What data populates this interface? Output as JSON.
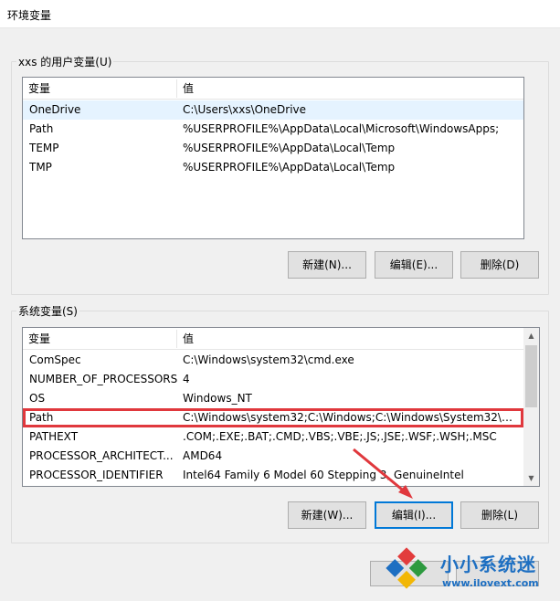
{
  "window": {
    "title": "环境变量"
  },
  "user_vars": {
    "group_label": "xxs 的用户变量(U)",
    "headers": {
      "name": "变量",
      "value": "值"
    },
    "rows": [
      {
        "name": "OneDrive",
        "value": "C:\\Users\\xxs\\OneDrive",
        "selected": true
      },
      {
        "name": "Path",
        "value": "%USERPROFILE%\\AppData\\Local\\Microsoft\\WindowsApps;"
      },
      {
        "name": "TEMP",
        "value": "%USERPROFILE%\\AppData\\Local\\Temp"
      },
      {
        "name": "TMP",
        "value": "%USERPROFILE%\\AppData\\Local\\Temp"
      }
    ],
    "buttons": {
      "new": "新建(N)...",
      "edit": "编辑(E)...",
      "delete": "删除(D)"
    }
  },
  "system_vars": {
    "group_label": "系统变量(S)",
    "headers": {
      "name": "变量",
      "value": "值"
    },
    "rows": [
      {
        "name": "ComSpec",
        "value": "C:\\Windows\\system32\\cmd.exe"
      },
      {
        "name": "NUMBER_OF_PROCESSORS",
        "value": "4"
      },
      {
        "name": "OS",
        "value": "Windows_NT"
      },
      {
        "name": "Path",
        "value": "C:\\Windows\\system32;C:\\Windows;C:\\Windows\\System32\\Wb...",
        "highlighted": true
      },
      {
        "name": "PATHEXT",
        "value": ".COM;.EXE;.BAT;.CMD;.VBS;.VBE;.JS;.JSE;.WSF;.WSH;.MSC"
      },
      {
        "name": "PROCESSOR_ARCHITECT...",
        "value": "AMD64"
      },
      {
        "name": "PROCESSOR_IDENTIFIER",
        "value": "Intel64 Family 6 Model 60 Stepping 3, GenuineIntel"
      }
    ],
    "buttons": {
      "new": "新建(W)...",
      "edit": "编辑(I)...",
      "delete": "删除(L)"
    }
  },
  "watermark": {
    "brand": "小小系统迷",
    "url": "www.ilovext.com"
  },
  "colors": {
    "highlight": "#e0383d",
    "focus": "#0078d7",
    "selection": "#e5f3ff",
    "watermark": "#1d6fc2"
  }
}
